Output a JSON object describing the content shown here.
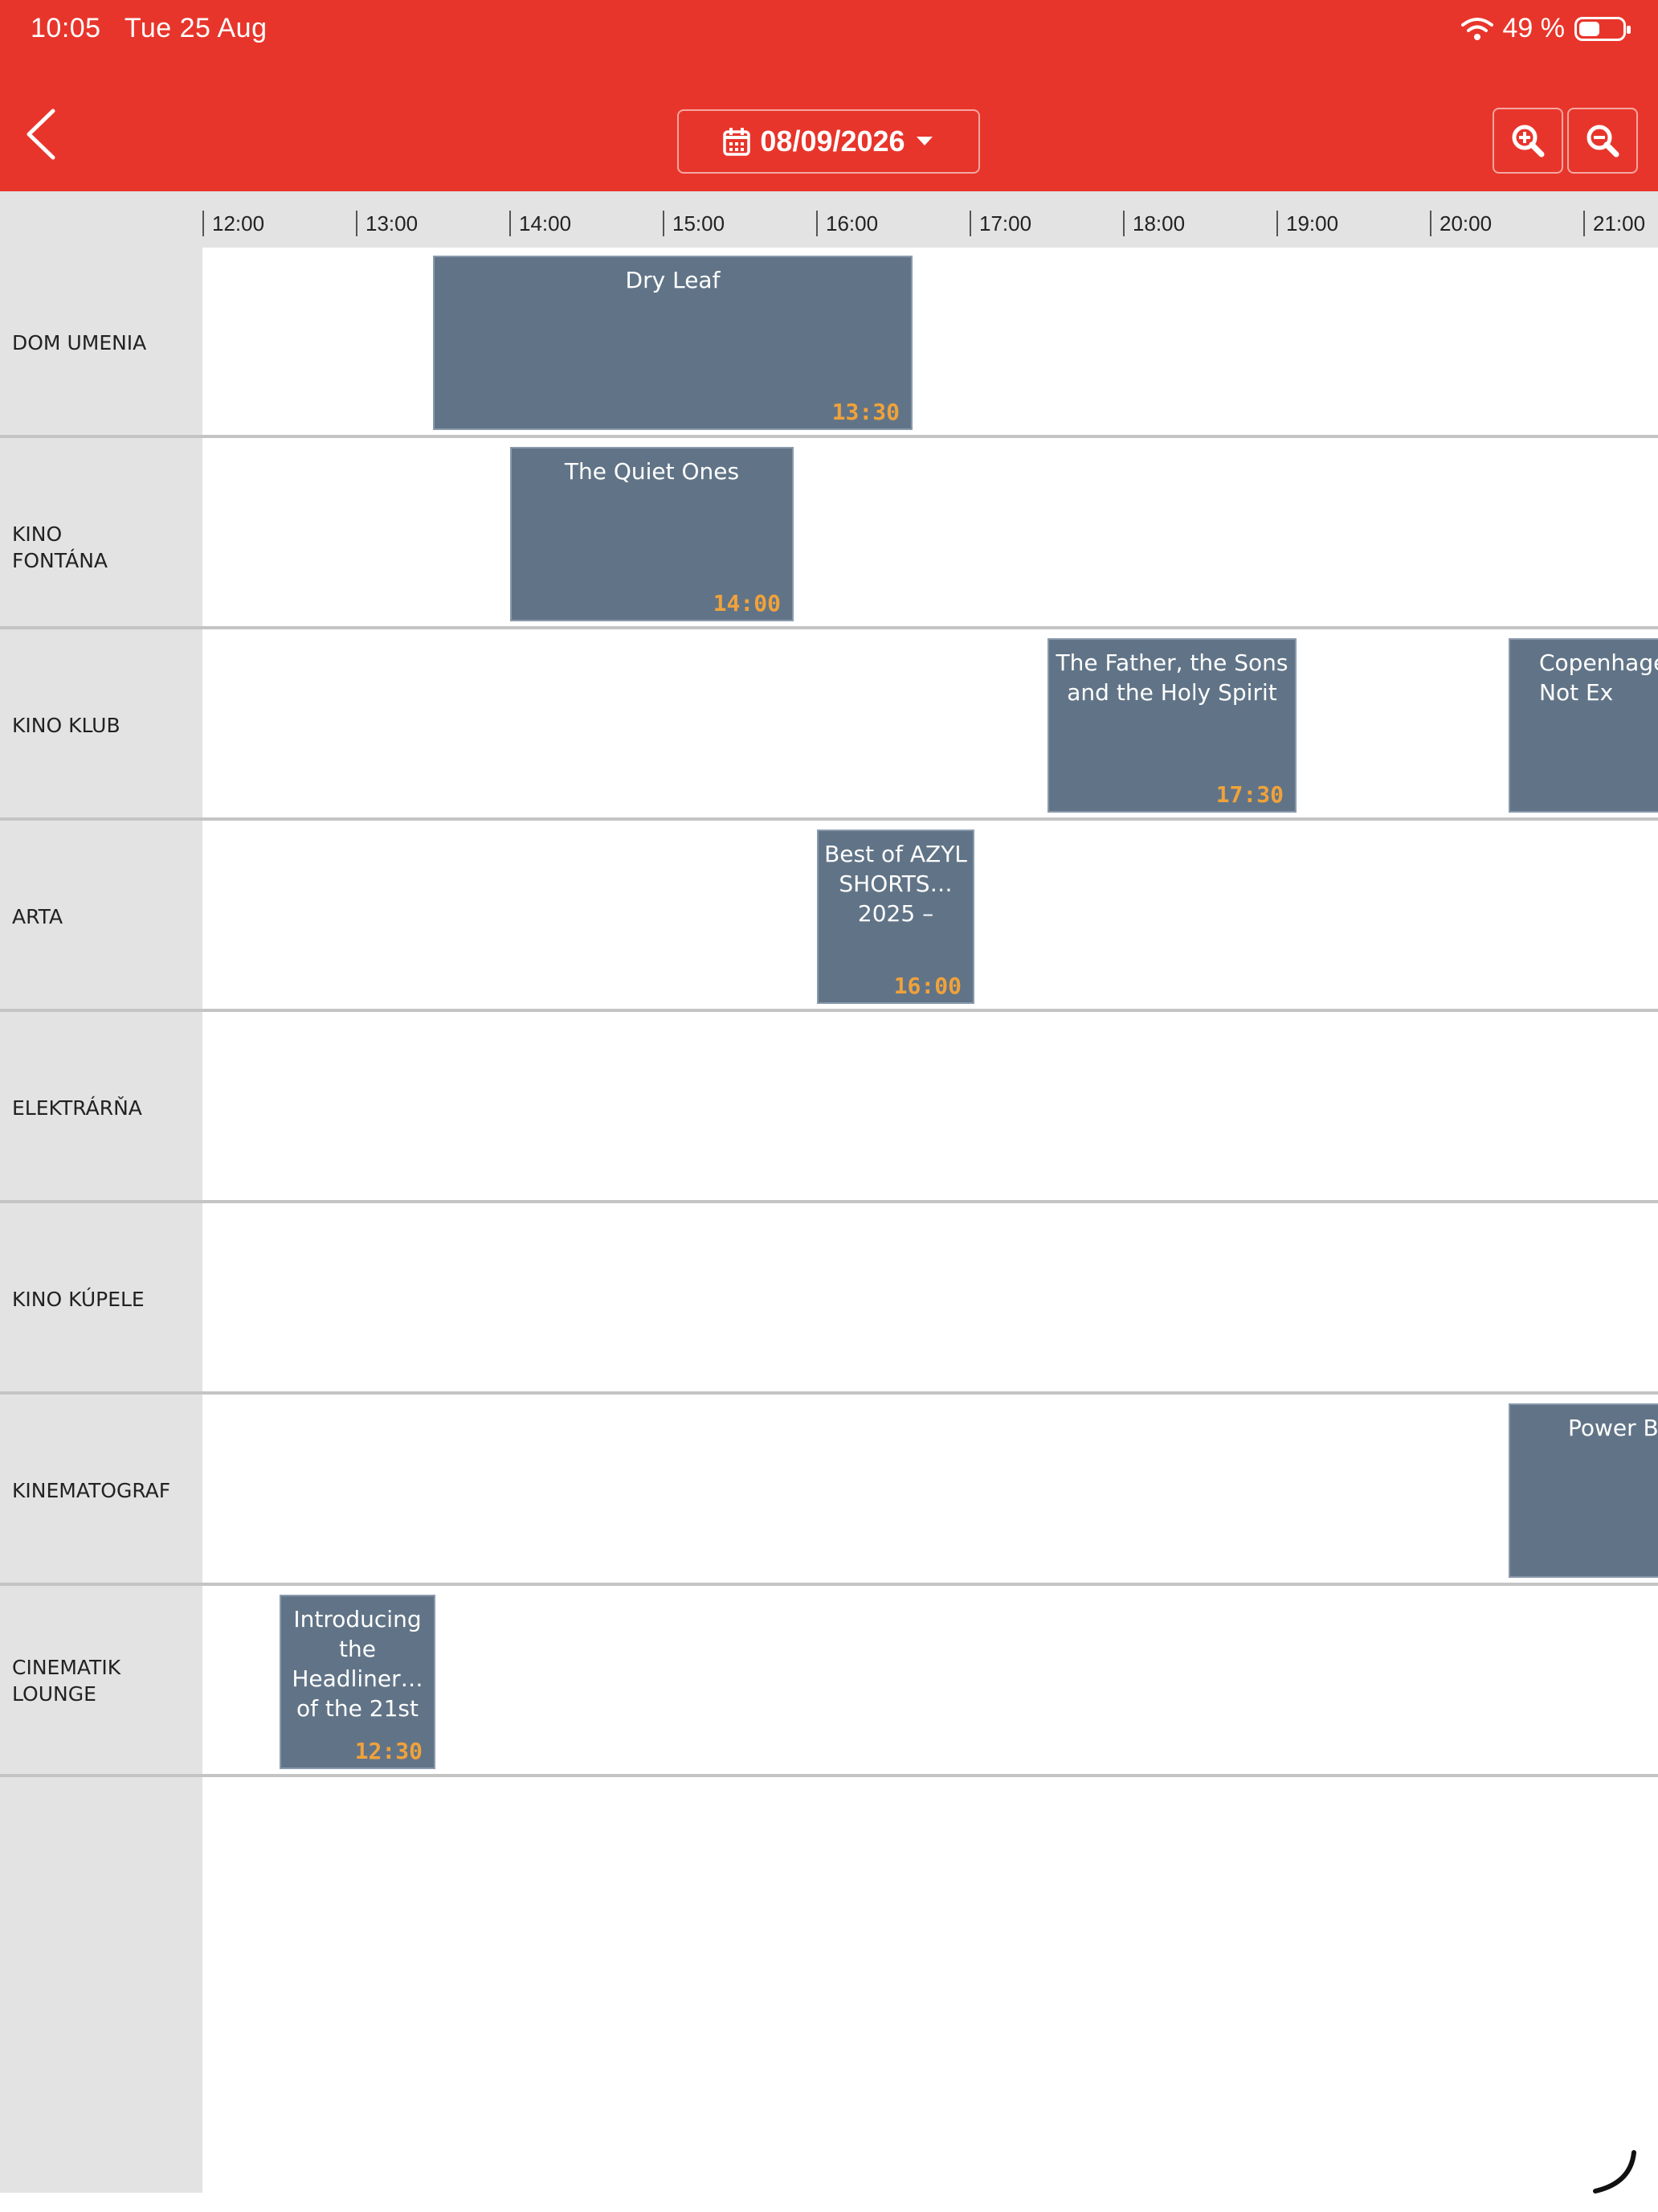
{
  "status_bar": {
    "time": "10:05",
    "date": "Tue 25 Aug",
    "battery": "49 %",
    "battery_level_percent": 49,
    "wifi_icon": "wifi-icon",
    "battery_icon": "battery-icon"
  },
  "header": {
    "back_icon": "chevron-left-icon",
    "date_label": "08/09/2026",
    "calendar_icon": "calendar-icon",
    "dropdown_icon": "caret-down-icon",
    "zoom_in_icon": "zoom-in-icon",
    "zoom_out_icon": "zoom-out-icon"
  },
  "timeline": {
    "hours": [
      "12:00",
      "13:00",
      "14:00",
      "15:00",
      "16:00",
      "17:00",
      "18:00",
      "19:00",
      "20:00",
      "21:00"
    ]
  },
  "venues": [
    {
      "name": "DOM UMENIA"
    },
    {
      "name": "KINO FONTÁNA"
    },
    {
      "name": "KINO KLUB"
    },
    {
      "name": "ARTA"
    },
    {
      "name": "ELEKTRÁRŇA"
    },
    {
      "name": "KINO KÚPELE"
    },
    {
      "name": "KINEMATOGRAF"
    },
    {
      "name": "CINEMATIK LOUNGE"
    }
  ],
  "events": [
    {
      "title": "Dry Leaf",
      "time": "13:30",
      "venue": "DOM UMENIA"
    },
    {
      "title": "The Quiet Ones",
      "time": "14:00",
      "venue": "KINO FONTÁNA"
    },
    {
      "title": "The Father, the Sons and the Holy Spirit",
      "time": "17:30",
      "venue": "KINO KLUB"
    },
    {
      "title": "Copenhage Not Ex",
      "time": "",
      "venue": "KINO KLUB"
    },
    {
      "title": "Best of AZYL SHORTS… 2025 –",
      "time": "16:00",
      "venue": "ARTA"
    },
    {
      "title": "Power B",
      "time": "",
      "venue": "KINEMATOGRAF"
    },
    {
      "title": "Introducing the Headliner… of the 21st",
      "time": "12:30",
      "venue": "CINEMATIK LOUNGE"
    }
  ],
  "colors": {
    "header_bg": "#e8352b",
    "event_bg": "#617487",
    "event_time": "#f0a23a",
    "side_bg": "#e3e3e3"
  }
}
